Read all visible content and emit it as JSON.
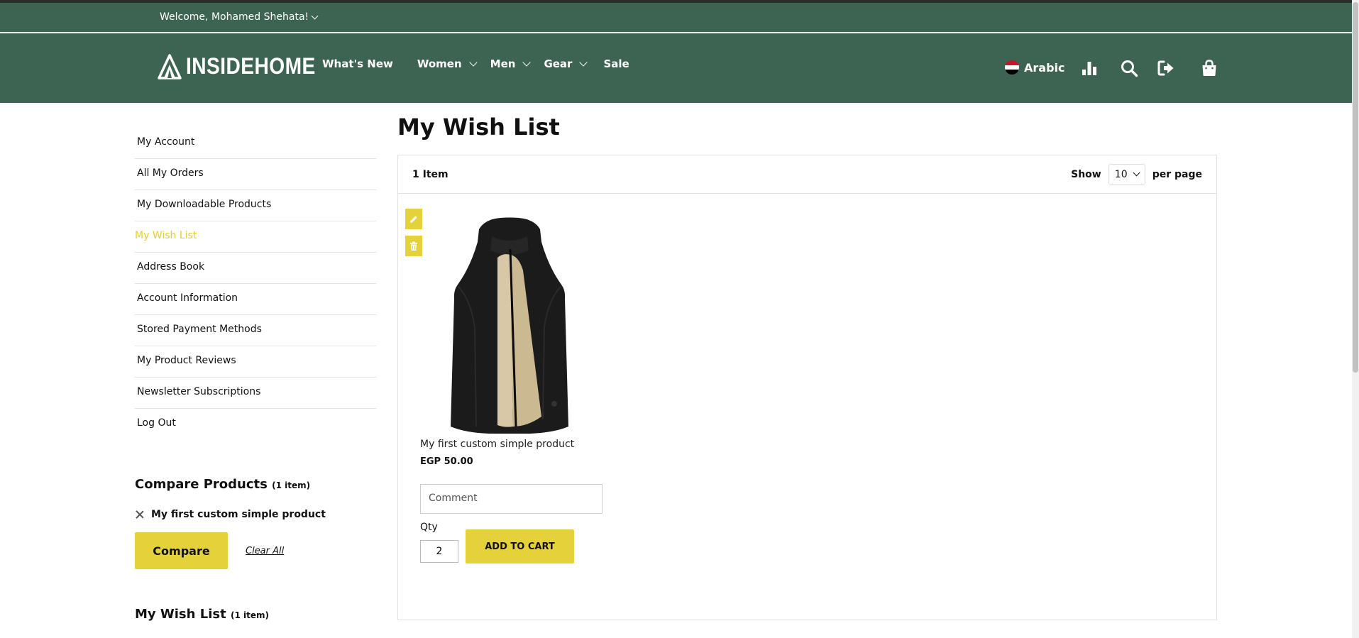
{
  "header": {
    "welcome": "Welcome, Mohamed Shehata!",
    "logo_text": "INSIDEHOME",
    "nav": [
      {
        "label": "What's New",
        "dropdown": false
      },
      {
        "label": "Women",
        "dropdown": true
      },
      {
        "label": "Men",
        "dropdown": true
      },
      {
        "label": "Gear",
        "dropdown": true
      },
      {
        "label": "Sale",
        "dropdown": false
      }
    ],
    "language": "Arabic",
    "icons": [
      "compare-icon",
      "search-icon",
      "logout-icon",
      "cart-icon"
    ]
  },
  "sidebar": {
    "items": [
      {
        "label": "My Account",
        "active": false
      },
      {
        "label": "All My Orders",
        "active": false
      },
      {
        "label": "My Downloadable Products",
        "active": false
      },
      {
        "label": "My Wish List",
        "active": true
      },
      {
        "label": "Address Book",
        "active": false
      },
      {
        "label": "Account Information",
        "active": false
      },
      {
        "label": "Stored Payment Methods",
        "active": false
      },
      {
        "label": "My Product Reviews",
        "active": false
      },
      {
        "label": "Newsletter Subscriptions",
        "active": false
      },
      {
        "label": "Log Out",
        "active": false
      }
    ],
    "compare": {
      "title": "Compare Products",
      "count": "(1 item)",
      "item": "My first custom simple product",
      "compare_label": "Compare",
      "clear_label": "Clear All"
    },
    "wishlist": {
      "title": "My Wish List",
      "count": "(1 item)"
    }
  },
  "main": {
    "title": "My Wish List",
    "toolbar": {
      "item_count": "1 Item",
      "show_label": "Show",
      "per_page_value": "10",
      "per_page_suffix": "per page"
    },
    "product": {
      "name": "My first custom simple product",
      "price": "EGP 50.00",
      "comment_placeholder": "Comment",
      "qty_label": "Qty",
      "qty": "2",
      "add_to_cart": "ADD TO CART"
    }
  },
  "colors": {
    "header_bg": "#3d6453",
    "accent": "#e5d23a",
    "active_link": "#e5cd2e"
  }
}
